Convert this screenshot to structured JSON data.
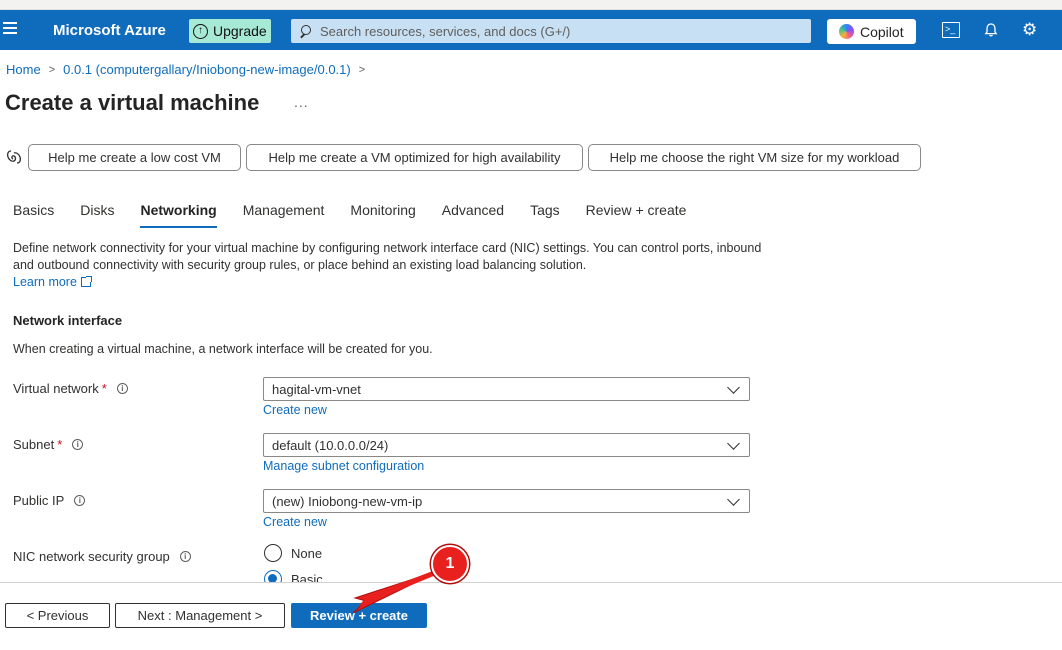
{
  "topbar": {
    "brand": "Microsoft Azure",
    "upgrade_label": "Upgrade",
    "search_placeholder": "Search resources, services, and docs (G+/)",
    "copilot_label": "Copilot"
  },
  "breadcrumb": {
    "home": "Home",
    "image": "0.0.1 (computergallary/Iniobong-new-image/0.0.1)"
  },
  "page": {
    "title": "Create a virtual machine",
    "more": "..."
  },
  "prompts": [
    "Help me create a low cost VM",
    "Help me create a VM optimized for high availability",
    "Help me choose the right VM size for my workload"
  ],
  "tabs": [
    "Basics",
    "Disks",
    "Networking",
    "Management",
    "Monitoring",
    "Advanced",
    "Tags",
    "Review + create"
  ],
  "active_tab": "Networking",
  "intro": {
    "description": "Define network connectivity for your virtual machine by configuring network interface card (NIC) settings. You can control ports, inbound and outbound connectivity with security group rules, or place behind an existing load balancing solution.",
    "learn_more": "Learn more"
  },
  "network_interface": {
    "title": "Network interface",
    "description": "When creating a virtual machine, a network interface will be created for you.",
    "virtual_network": {
      "label": "Virtual network",
      "required": "*",
      "value": "hagital-vm-vnet",
      "link": "Create new"
    },
    "subnet": {
      "label": "Subnet",
      "required": "*",
      "value": "default (10.0.0.0/24)",
      "link": "Manage subnet configuration"
    },
    "public_ip": {
      "label": "Public IP",
      "value": "(new) Iniobong-new-vm-ip",
      "link": "Create new"
    },
    "nsg": {
      "label": "NIC network security group",
      "options": [
        "None",
        "Basic"
      ],
      "selected": "Basic"
    }
  },
  "footer": {
    "previous": "< Previous",
    "next": "Next : Management >",
    "review": "Review + create"
  },
  "annotation": {
    "step": "1",
    "color": "#e8201e"
  }
}
